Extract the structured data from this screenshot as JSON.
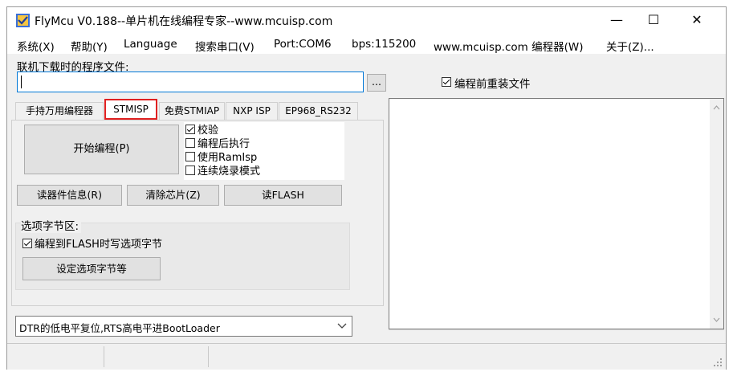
{
  "window": {
    "title": "FlyMcu V0.188--单片机在线编程专家--www.mcuisp.com",
    "minimize_glyph": "—",
    "maximize_glyph": "☐",
    "close_glyph": "✕"
  },
  "menu": [
    "系统(X)",
    "帮助(Y)",
    "Language",
    "搜索串口(V)",
    "Port:COM6",
    "bps:115200",
    "www.mcuisp.com 编程器(W)",
    "关于(Z)..."
  ],
  "file_section": {
    "label": "联机下载时的程序文件:",
    "file_value": "",
    "browse_label": "...",
    "reload_checkbox": {
      "label": "编程前重装文件",
      "checked": true
    }
  },
  "tabs": [
    {
      "label": "手持万用编程器",
      "active": false
    },
    {
      "label": "STMISP",
      "active": true
    },
    {
      "label": "免费STMIAP",
      "active": false
    },
    {
      "label": "NXP ISP",
      "active": false
    },
    {
      "label": "EP968_RS232",
      "active": false
    }
  ],
  "stmisp": {
    "start_button": "开始编程(P)",
    "options": [
      {
        "label": "校验",
        "checked": true
      },
      {
        "label": "编程后执行",
        "checked": false
      },
      {
        "label": "使用RamIsp",
        "checked": false
      },
      {
        "label": "连续烧录模式",
        "checked": false
      }
    ],
    "read_info_button": "读器件信息(R)",
    "erase_button": "清除芯片(Z)",
    "read_flash_button": "读FLASH",
    "option_bytes": {
      "group_label": "选项字节区:",
      "write_checkbox": {
        "label": "编程到FLASH时写选项字节",
        "checked": true
      },
      "set_button": "设定选项字节等"
    }
  },
  "reset_mode": {
    "selected": "DTR的低电平复位,RTS高电平进BootLoader"
  },
  "log": {
    "text": ""
  },
  "colors": {
    "highlight_red": "#e02020",
    "window_bg": "#f0f0f0",
    "input_border": "#7a7a7a",
    "focus_border": "#0078d7"
  }
}
